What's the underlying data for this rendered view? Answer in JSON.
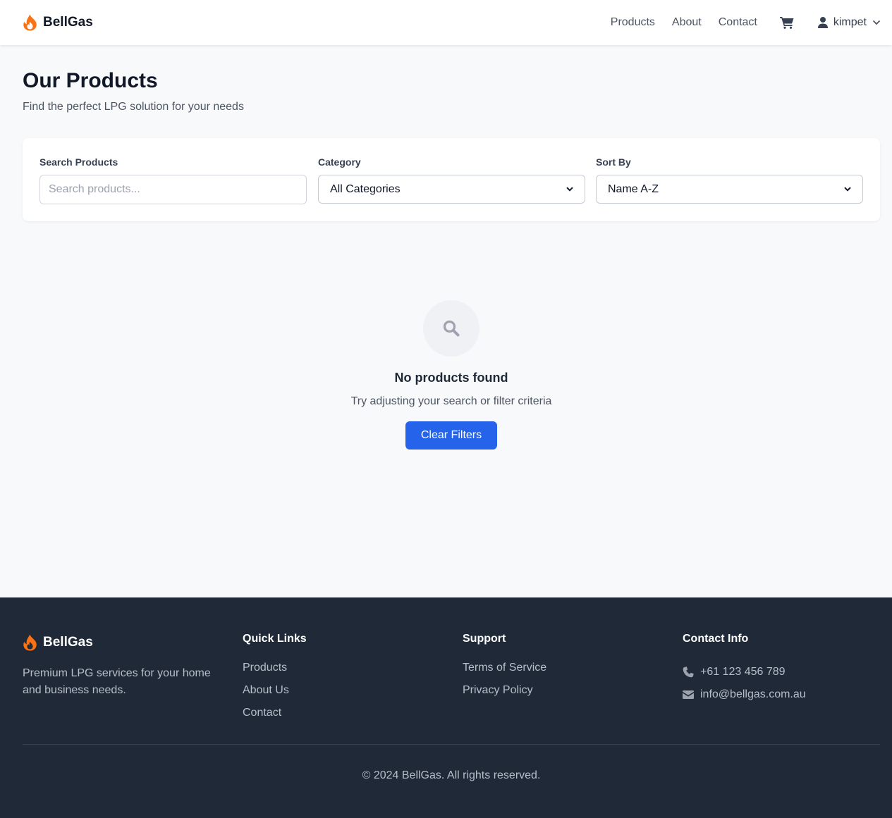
{
  "brand": {
    "name": "BellGas",
    "accent": "#f97316"
  },
  "nav": {
    "links": [
      "Products",
      "About",
      "Contact"
    ],
    "cart_icon": "cart-icon",
    "user": {
      "name": "kimpet",
      "icon": "user-icon"
    }
  },
  "page": {
    "title": "Our Products",
    "subtitle": "Find the perfect LPG solution for your needs"
  },
  "filters": {
    "search": {
      "label": "Search Products",
      "placeholder": "Search products...",
      "value": ""
    },
    "category": {
      "label": "Category",
      "selected": "All Categories"
    },
    "sort": {
      "label": "Sort By",
      "selected": "Name A-Z"
    }
  },
  "empty_state": {
    "icon": "search-icon",
    "title": "No products found",
    "text": "Try adjusting your search or filter criteria",
    "button": "Clear Filters",
    "button_color": "#2563eb"
  },
  "footer": {
    "brand": "BellGas",
    "description": "Premium LPG services for your home and business needs.",
    "quick_links": {
      "title": "Quick Links",
      "items": [
        "Products",
        "About Us",
        "Contact"
      ]
    },
    "support": {
      "title": "Support",
      "items": [
        "Terms of Service",
        "Privacy Policy"
      ]
    },
    "contact": {
      "title": "Contact Info",
      "phone": "+61 123 456 789",
      "email": "info@bellgas.com.au"
    },
    "copyright": "© 2024 BellGas. All rights reserved.",
    "background": "#1f2937"
  }
}
